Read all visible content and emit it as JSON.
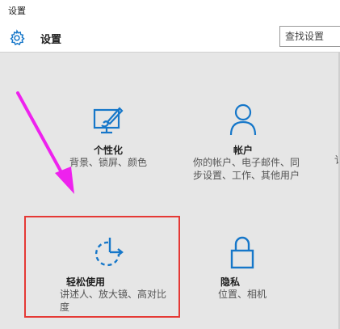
{
  "window": {
    "title": "设置"
  },
  "header": {
    "title": "设置",
    "search_placeholder": "查找设置"
  },
  "tiles": [
    {
      "label": "个性化",
      "desc": "背景、锁屏、颜色"
    },
    {
      "label": "帐户",
      "desc": "你的帐户、电子邮件、同步设置、工作、其他用户"
    },
    {
      "label": "轻松使用",
      "desc": "讲述人、放大镜、高对比度"
    },
    {
      "label": "隐私",
      "desc": "位置、相机"
    }
  ],
  "edge_text": "讠",
  "colors": {
    "accent": "#1677c9",
    "highlight": "#e53935",
    "arrow": "#ee22ee"
  }
}
